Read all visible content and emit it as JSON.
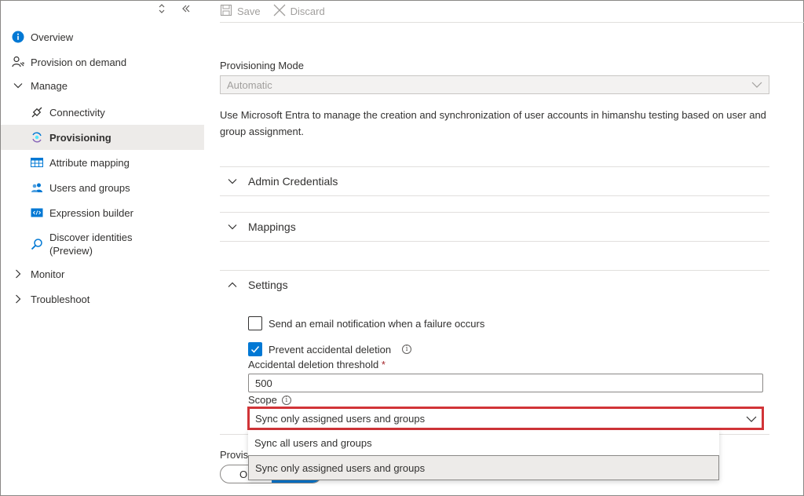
{
  "sidebar": {
    "items": [
      {
        "label": "Overview",
        "icon": "info-icon"
      },
      {
        "label": "Provision on demand",
        "icon": "person-sync-icon"
      },
      {
        "label": "Manage",
        "icon": "chevron-down-icon"
      },
      {
        "label": "Connectivity",
        "icon": "plug-icon"
      },
      {
        "label": "Provisioning",
        "icon": "provisioning-icon"
      },
      {
        "label": "Attribute mapping",
        "icon": "table-icon"
      },
      {
        "label": "Users and groups",
        "icon": "users-icon"
      },
      {
        "label": "Expression builder",
        "icon": "code-window-icon"
      },
      {
        "label": "Discover identities\n(Preview)",
        "icon": "search-icon"
      },
      {
        "label": "Monitor",
        "icon": "chevron-right-icon"
      },
      {
        "label": "Troubleshoot",
        "icon": "chevron-right-icon"
      }
    ]
  },
  "toolbar": {
    "save_label": "Save",
    "discard_label": "Discard"
  },
  "main": {
    "provisioning_mode_label": "Provisioning Mode",
    "provisioning_mode_value": "Automatic",
    "description": "Use Microsoft Entra to manage the creation and synchronization of user accounts in himanshu testing based on user and group assignment.",
    "sections": [
      {
        "label": "Admin Credentials",
        "expanded": false
      },
      {
        "label": "Mappings",
        "expanded": false
      },
      {
        "label": "Settings",
        "expanded": true
      }
    ],
    "settings": {
      "email_notification_label": "Send an email notification when a failure occurs",
      "email_notification_checked": false,
      "prevent_deletion_label": "Prevent accidental deletion",
      "prevent_deletion_checked": true,
      "threshold_label": "Accidental deletion threshold",
      "threshold_required_mark": "*",
      "threshold_value": "500",
      "scope_label": "Scope",
      "scope_value": "Sync only assigned users and groups",
      "scope_options": [
        "Sync all users and groups",
        "Sync only assigned users and groups"
      ]
    },
    "provisioning_status_label_partial": "Provis",
    "toggle_partial_text": "O"
  },
  "colors": {
    "accent": "#0078d4",
    "highlight_border": "#d13438",
    "selected_bg": "#edebe9"
  }
}
